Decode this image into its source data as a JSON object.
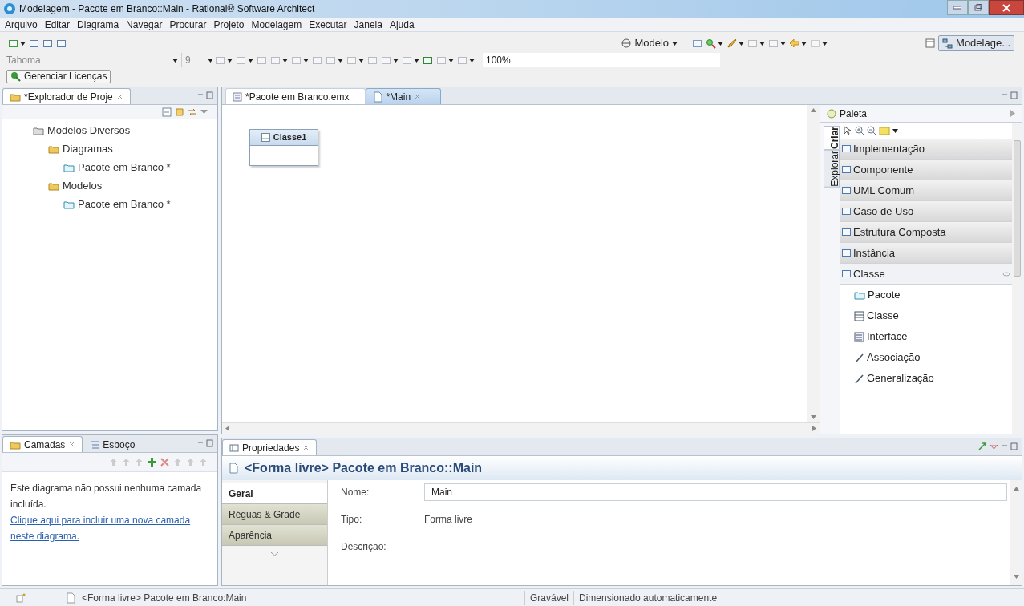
{
  "window": {
    "title": "Modelagem - Pacote em Branco::Main - Rational® Software Architect"
  },
  "menu": [
    "Arquivo",
    "Editar",
    "Diagrama",
    "Navegar",
    "Procurar",
    "Projeto",
    "Modelagem",
    "Executar",
    "Janela",
    "Ajuda"
  ],
  "toolbar": {
    "model_selector": "Modelo",
    "perspective": "Modelage...",
    "font": "Tahoma",
    "font_size": "9",
    "zoom": "100%",
    "license_button": "Gerenciar Licenças"
  },
  "explorer": {
    "tab": "*Explorador de Proje",
    "tree": [
      {
        "label": "Modelos Diversos",
        "kind": "project",
        "children": [
          {
            "label": "Diagramas",
            "kind": "folder",
            "children": [
              {
                "label": "Pacote em Branco *",
                "kind": "package"
              }
            ]
          },
          {
            "label": "Modelos",
            "kind": "folder",
            "children": [
              {
                "label": "Pacote em Branco *",
                "kind": "package"
              }
            ]
          }
        ]
      }
    ]
  },
  "editor": {
    "tabs": [
      {
        "label": "*Pacote em Branco.emx",
        "selected": false
      },
      {
        "label": "*Main",
        "selected": true
      }
    ],
    "class_box": {
      "name": "Classe1"
    }
  },
  "palette": {
    "title": "Paleta",
    "side_tabs": [
      {
        "label": "Criar",
        "selected": true
      },
      {
        "label": "Explorar",
        "selected": false
      }
    ],
    "drawers": [
      {
        "label": "Implementação",
        "expanded": false
      },
      {
        "label": "Componente",
        "expanded": false
      },
      {
        "label": "UML Comum",
        "expanded": false
      },
      {
        "label": "Caso de Uso",
        "expanded": false
      },
      {
        "label": "Estrutura Composta",
        "expanded": false
      },
      {
        "label": "Instância",
        "expanded": false
      },
      {
        "label": "Classe",
        "expanded": true,
        "items": [
          {
            "label": "Pacote",
            "kind": "package"
          },
          {
            "label": "Classe",
            "kind": "class"
          },
          {
            "label": "Interface",
            "kind": "interface"
          },
          {
            "label": "Associação",
            "kind": "line"
          },
          {
            "label": "Generalização",
            "kind": "line"
          }
        ]
      }
    ]
  },
  "layers": {
    "tabs": [
      {
        "label": "Camadas",
        "selected": true
      },
      {
        "label": "Esboço",
        "selected": false
      }
    ],
    "message": "Este diagrama não possui nenhuma camada incluída.",
    "link": "Clique aqui para incluir uma nova camada neste diagrama."
  },
  "properties": {
    "tab": "Propriedades",
    "heading": "<Forma livre> Pacote em Branco::Main",
    "tabs": [
      {
        "label": "Geral",
        "selected": true
      },
      {
        "label": "Réguas & Grade",
        "selected": false
      },
      {
        "label": "Aparência",
        "selected": false
      }
    ],
    "fields": [
      {
        "label": "Nome:",
        "value": "Main",
        "kind": "input"
      },
      {
        "label": "Tipo:",
        "value": "Forma livre",
        "kind": "text"
      },
      {
        "label": "Descrição:",
        "kind": "text"
      }
    ]
  },
  "status_bar": [
    "<Forma livre> Pacote em Branco:Main",
    "Gravável",
    "Dimensionado automaticamente"
  ]
}
